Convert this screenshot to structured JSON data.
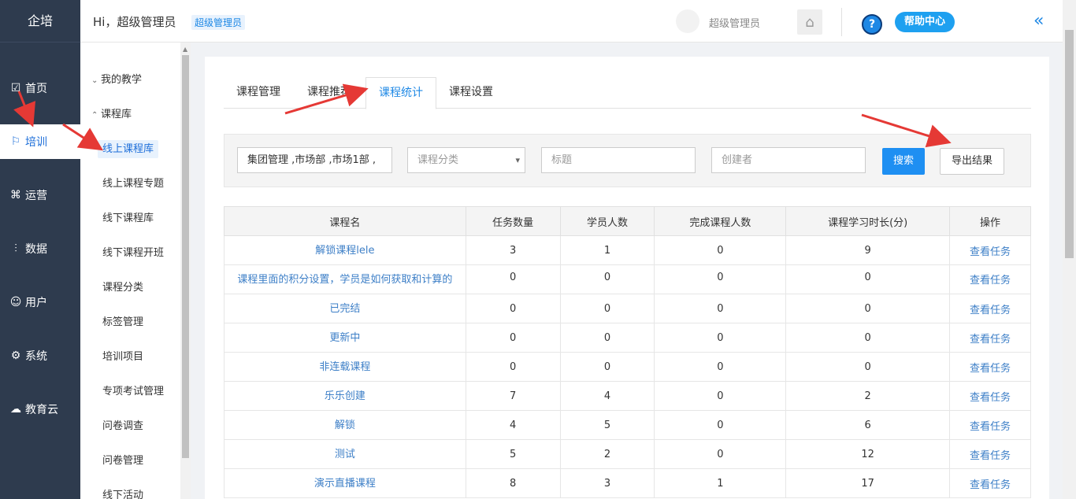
{
  "leftnav": {
    "brand": "企培",
    "items": [
      {
        "icon": "home-chart-icon",
        "glyph": "☑",
        "label": "首页"
      },
      {
        "icon": "training-icon",
        "glyph": "⚐",
        "label": "培训"
      },
      {
        "icon": "operations-icon",
        "glyph": "⌘",
        "label": "运营"
      },
      {
        "icon": "data-chart-icon",
        "glyph": "⫶",
        "label": "数据"
      },
      {
        "icon": "user-icon",
        "glyph": "☺",
        "label": "用户"
      },
      {
        "icon": "gear-icon",
        "glyph": "⚙",
        "label": "系统"
      },
      {
        "icon": "cloud-icon",
        "glyph": "☁",
        "label": "教育云"
      }
    ]
  },
  "header": {
    "greeting": "Hi，超级管理员",
    "role_badge": "超级管理员",
    "username": "超级管理员",
    "home_glyph": "⌂",
    "help_glyph": "?",
    "help_label": "帮助中心",
    "collapse_glyph": "«"
  },
  "subnav": {
    "groups": [
      {
        "label": "我的教学",
        "arrow": "⌄"
      },
      {
        "label": "课程库",
        "arrow": "⌃"
      }
    ],
    "children": [
      "线上课程库",
      "线上课程专题",
      "线下课程库",
      "线下课程开班",
      "课程分类",
      "标签管理",
      "培训项目",
      "专项考试管理",
      "问卷调查",
      "问卷管理",
      "线下活动"
    ]
  },
  "tabs": [
    "课程管理",
    "课程推荐",
    "课程统计",
    "课程设置"
  ],
  "filters": {
    "org_value": "集团管理 ,市场部 ,市场1部 ,",
    "category_placeholder": "课程分类",
    "title_placeholder": "标题",
    "creator_placeholder": "创建者",
    "search_label": "搜索",
    "export_label": "导出结果"
  },
  "table": {
    "headers": [
      "课程名",
      "任务数量",
      "学员人数",
      "完成课程人数",
      "课程学习时长(分)",
      "操作"
    ],
    "op_label": "查看任务",
    "rows": [
      {
        "name": "解锁课程lele",
        "tasks": "3",
        "students": "1",
        "completed": "0",
        "minutes": "9"
      },
      {
        "name": "课程里面的积分设置，学员是如何获取和计算的",
        "tasks": "0",
        "students": "0",
        "completed": "0",
        "minutes": "0"
      },
      {
        "name": "已完结",
        "tasks": "0",
        "students": "0",
        "completed": "0",
        "minutes": "0"
      },
      {
        "name": "更新中",
        "tasks": "0",
        "students": "0",
        "completed": "0",
        "minutes": "0"
      },
      {
        "name": "非连载课程",
        "tasks": "0",
        "students": "0",
        "completed": "0",
        "minutes": "0"
      },
      {
        "name": "乐乐创建",
        "tasks": "7",
        "students": "4",
        "completed": "0",
        "minutes": "2"
      },
      {
        "name": "解锁",
        "tasks": "4",
        "students": "5",
        "completed": "0",
        "minutes": "6"
      },
      {
        "name": "测试",
        "tasks": "5",
        "students": "2",
        "completed": "0",
        "minutes": "12"
      },
      {
        "name": "演示直播课程",
        "tasks": "8",
        "students": "3",
        "completed": "1",
        "minutes": "17"
      }
    ]
  },
  "colors": {
    "accent": "#1e88e5",
    "nav_bg": "#2e3b4e",
    "annotation": "#e53935"
  }
}
